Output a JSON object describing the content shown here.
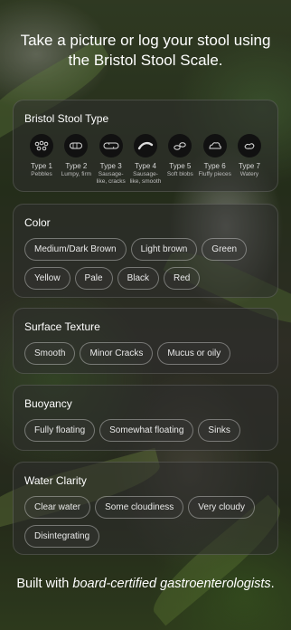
{
  "headline": "Take a picture or log your stool using the Bristol Stool Scale.",
  "bristol": {
    "title": "Bristol Stool Type",
    "types": [
      {
        "name": "Type 1",
        "desc": "Pebbles",
        "icon": "pebbles-icon"
      },
      {
        "name": "Type 2",
        "desc": "Lumpy, firm",
        "icon": "lumpy-icon"
      },
      {
        "name": "Type 3",
        "desc": "Sausage-like, cracks",
        "icon": "cracked-sausage-icon"
      },
      {
        "name": "Type 4",
        "desc": "Sausage-like, smooth",
        "icon": "smooth-sausage-icon"
      },
      {
        "name": "Type 5",
        "desc": "Soft blobs",
        "icon": "soft-blobs-icon"
      },
      {
        "name": "Type 6",
        "desc": "Fluffy pieces",
        "icon": "fluffy-icon"
      },
      {
        "name": "Type 7",
        "desc": "Watery",
        "icon": "watery-icon"
      }
    ]
  },
  "color": {
    "title": "Color",
    "options": [
      "Medium/Dark Brown",
      "Light brown",
      "Green",
      "Yellow",
      "Pale",
      "Black",
      "Red"
    ]
  },
  "texture": {
    "title": "Surface Texture",
    "options": [
      "Smooth",
      "Minor Cracks",
      "Mucus or oily"
    ]
  },
  "buoyancy": {
    "title": "Buoyancy",
    "options": [
      "Fully floating",
      "Somewhat floating",
      "Sinks"
    ]
  },
  "clarity": {
    "title": "Water Clarity",
    "options": [
      "Clear water",
      "Some cloudiness",
      "Very cloudy",
      "Disintegrating"
    ]
  },
  "footer": {
    "prefix": "Built with ",
    "emphasis": "board-certified gastroenterologists",
    "suffix": "."
  }
}
